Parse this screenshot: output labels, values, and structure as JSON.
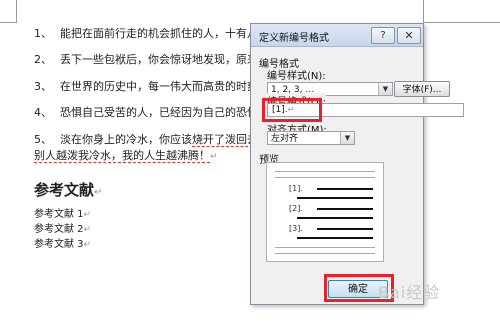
{
  "document": {
    "paragraphs": [
      {
        "num": "1、",
        "text": "能把在面前行走的机会抓住的人，十有八"
      },
      {
        "num": "2、",
        "text": "丢下一些包袱后，你会惊讶地发现，原来"
      },
      {
        "num": "3、",
        "text": "在世界的历史中，每一伟大而高贵的时刻"
      },
      {
        "num": "4、",
        "text": "恐惧自己受苦的人，已经因为自己的恐惧"
      },
      {
        "num": "5、",
        "text_a": "淡在你身上的冷水，你应该",
        "text_highlight": "烧开了泼回去",
        "text_b": "别人越泼我冷水，我的人生越沸腾！"
      }
    ],
    "heading": "参考文献",
    "references": [
      "参考文献 1",
      "参考文献 2",
      "参考文献 3"
    ],
    "pilcrow": "↵"
  },
  "dialog": {
    "title": "定义新编号格式",
    "help_label": "?",
    "close_label": "✕",
    "group_label": "编号格式",
    "style_label": "编号样式(N):",
    "style_value": "1, 2, 3, …",
    "font_button": "字体(F)...",
    "format_label": "编号格式(O):",
    "format_value": "[1].",
    "align_label": "对齐方式(M):",
    "align_value": "左对齐",
    "preview_label": "预览",
    "preview_numbers": [
      "[1].",
      "[2].",
      "[3]."
    ],
    "ok_button": "确定"
  },
  "watermark": "Bai经验"
}
